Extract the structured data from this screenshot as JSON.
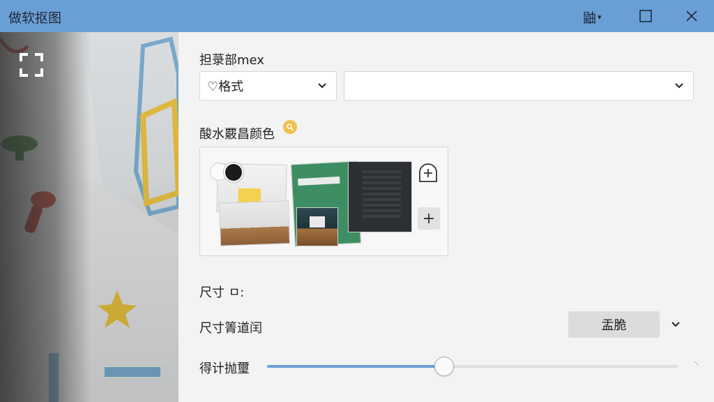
{
  "window": {
    "title": "做软抠图",
    "menu_label": "鼬",
    "caret": "▾"
  },
  "format": {
    "label": "担菉部mex",
    "select_value": "♡格式",
    "second_select_value": ""
  },
  "background": {
    "label": "酸水覈昌颜色",
    "add_label": "+"
  },
  "size": {
    "label": "尺寸 ㅁ:"
  },
  "size_options": {
    "label": "尺寸箐道闰",
    "button_label": "盂脆"
  },
  "slider": {
    "label": "得计抛璽",
    "value_fraction": 0.43
  },
  "colors": {
    "titlebar": "#6a9fd6",
    "accent": "#6a9fd6",
    "panel": "#f3f3f3"
  }
}
